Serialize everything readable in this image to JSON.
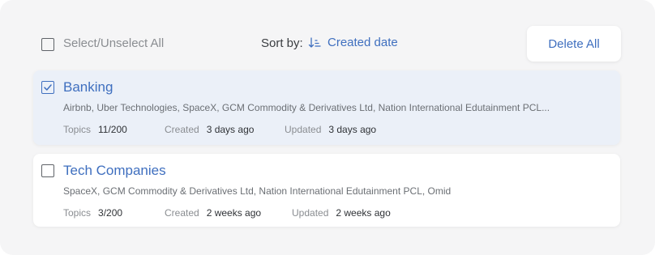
{
  "toolbar": {
    "select_all_label": "Select/Unselect All",
    "sort_by_label": "Sort by:",
    "sort_value": "Created date",
    "sort_icon": "sort-descending-icon",
    "delete_all_label": "Delete All"
  },
  "colors": {
    "accent": "#3f6fbf",
    "panel_bg": "#f5f5f6",
    "selected_card_bg": "#ebf0f8"
  },
  "groups": [
    {
      "title": "Banking",
      "checked": true,
      "companies": "Airbnb, Uber Technologies, SpaceX, GCM Commodity & Derivatives Ltd, Nation International Edutainment PCL...",
      "topics_label": "Topics",
      "topics_value": "11/200",
      "created_label": "Created",
      "created_value": "3 days ago",
      "updated_label": "Updated",
      "updated_value": "3 days ago"
    },
    {
      "title": "Tech Companies",
      "checked": false,
      "companies": "SpaceX, GCM Commodity & Derivatives Ltd, Nation International Edutainment PCL, Omid",
      "topics_label": "Topics",
      "topics_value": "3/200",
      "created_label": "Created",
      "created_value": "2 weeks ago",
      "updated_label": "Updated",
      "updated_value": "2 weeks ago"
    }
  ]
}
